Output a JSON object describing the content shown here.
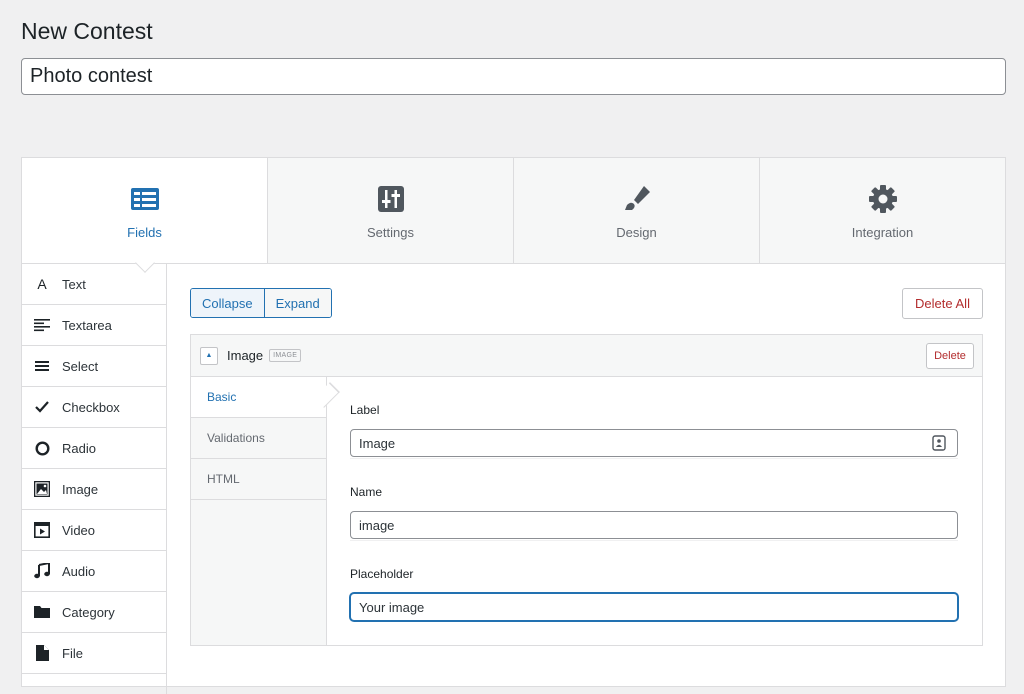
{
  "page": {
    "title": "New Contest"
  },
  "contest": {
    "title_value": "Photo contest"
  },
  "tabs": [
    {
      "label": "Fields",
      "icon": "fields-icon",
      "active": true
    },
    {
      "label": "Settings",
      "icon": "settings-sliders-icon"
    },
    {
      "label": "Design",
      "icon": "paintbrush-icon"
    },
    {
      "label": "Integration",
      "icon": "gear-icon"
    }
  ],
  "field_types": [
    {
      "label": "Text",
      "icon": "text-icon"
    },
    {
      "label": "Textarea",
      "icon": "textarea-icon"
    },
    {
      "label": "Select",
      "icon": "select-icon"
    },
    {
      "label": "Checkbox",
      "icon": "checkbox-icon"
    },
    {
      "label": "Radio",
      "icon": "radio-icon"
    },
    {
      "label": "Image",
      "icon": "image-icon"
    },
    {
      "label": "Video",
      "icon": "video-icon"
    },
    {
      "label": "Audio",
      "icon": "audio-icon"
    },
    {
      "label": "Category",
      "icon": "category-icon"
    },
    {
      "label": "File",
      "icon": "file-icon"
    }
  ],
  "toolbar": {
    "collapse_label": "Collapse",
    "expand_label": "Expand",
    "delete_all_label": "Delete All"
  },
  "field": {
    "name": "Image",
    "badge": "IMAGE",
    "delete_label": "Delete",
    "subtabs": [
      {
        "label": "Basic",
        "active": true
      },
      {
        "label": "Validations"
      },
      {
        "label": "HTML"
      }
    ],
    "label_caption": "Label",
    "label_value": "Image",
    "name_caption": "Name",
    "name_value": "image",
    "placeholder_caption": "Placeholder",
    "placeholder_value": "Your image"
  },
  "colors": {
    "accent": "#2271b1",
    "danger": "#b32d2e",
    "border": "#dcdcde"
  }
}
